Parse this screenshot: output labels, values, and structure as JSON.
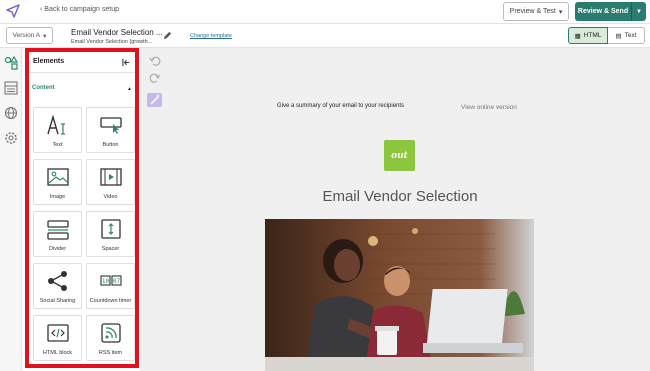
{
  "topbar": {
    "back_label": "Back to campaign setup",
    "preview_label": "Preview & Test",
    "review_label": "Review & Send"
  },
  "secondbar": {
    "version_label": "Version A",
    "subject_title": "Email Vendor Selection ...",
    "subject_sub": "Email Vendor Selection {growth...",
    "change_template": "Change template",
    "mode_html": "HTML",
    "mode_text": "Text"
  },
  "elements": {
    "title": "Elements",
    "section": "Content",
    "tiles": [
      {
        "label": "Text",
        "icon": "text-icon"
      },
      {
        "label": "Button",
        "icon": "button-icon"
      },
      {
        "label": "Image",
        "icon": "image-icon"
      },
      {
        "label": "Video",
        "icon": "video-icon"
      },
      {
        "label": "Divider",
        "icon": "divider-icon"
      },
      {
        "label": "Spacer",
        "icon": "spacer-icon"
      },
      {
        "label": "Social Sharing",
        "icon": "share-icon"
      },
      {
        "label": "Countdown timer",
        "icon": "timer-icon"
      },
      {
        "label": "HTML block",
        "icon": "code-icon"
      },
      {
        "label": "RSS item",
        "icon": "rss-icon"
      }
    ]
  },
  "email": {
    "preheader": "Give a summary of your email to your recipients",
    "view_online": "View online version",
    "logo_text": "out",
    "title": "Email Vendor Selection"
  },
  "colors": {
    "accent": "#2a7d6e",
    "highlight": "#e4101c",
    "logo_bg": "#8cc63e"
  }
}
